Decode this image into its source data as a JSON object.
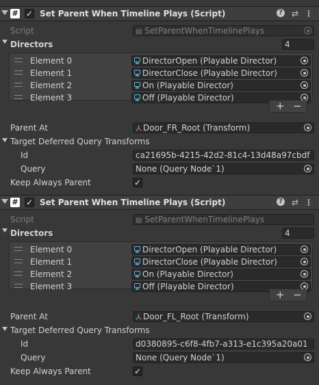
{
  "components": [
    {
      "header_title": "Set Parent When Timeline Plays (Script)",
      "script_label": "Script",
      "script_value": "SetParentWhenTimelinePlays",
      "directors_label": "Directors",
      "directors_count": "4",
      "elements": [
        {
          "label": "Element 0",
          "value": "DirectorOpen (Playable Director)"
        },
        {
          "label": "Element 1",
          "value": "DirectorClose (Playable Director)"
        },
        {
          "label": "Element 2",
          "value": "On (Playable Director)"
        },
        {
          "label": "Element 3",
          "value": "Off (Playable Director)"
        }
      ],
      "parent_at_label": "Parent At",
      "parent_at_value": "Door_FR_Root (Transform)",
      "target_label": "Target Deferred Query Transforms",
      "id_label": "Id",
      "id_value": "ca21695b-4215-42d2-81c4-13d48a97cbdf",
      "query_label": "Query",
      "query_value": "None (Query Node`1)",
      "keep_label": "Keep Always Parent",
      "keep_checked": true
    },
    {
      "header_title": "Set Parent When Timeline Plays (Script)",
      "script_label": "Script",
      "script_value": "SetParentWhenTimelinePlays",
      "directors_label": "Directors",
      "directors_count": "4",
      "elements": [
        {
          "label": "Element 0",
          "value": "DirectorOpen (Playable Director)"
        },
        {
          "label": "Element 1",
          "value": "DirectorClose (Playable Director)"
        },
        {
          "label": "Element 2",
          "value": "On (Playable Director)"
        },
        {
          "label": "Element 3",
          "value": "Off (Playable Director)"
        }
      ],
      "parent_at_label": "Parent At",
      "parent_at_value": "Door_FL_Root (Transform)",
      "target_label": "Target Deferred Query Transforms",
      "id_label": "Id",
      "id_value": "d0380895-c6f8-4fb7-a313-e1c395a20a01",
      "query_label": "Query",
      "query_value": "None (Query Node`1)",
      "keep_label": "Keep Always Parent",
      "keep_checked": true
    }
  ],
  "icons": {
    "fold": "fold-triangle-icon",
    "script": "script-hash-icon",
    "help": "help-icon",
    "presets": "presets-sliders-icon",
    "menu": "kebab-menu-icon",
    "picker": "object-picker-icon",
    "director": "playable-director-icon",
    "transform": "transform-icon",
    "add": "plus-icon",
    "remove": "minus-icon",
    "check": "checkmark-icon"
  },
  "colors": {
    "background": "#383838",
    "header": "#3e3e3e",
    "field": "#2a2a2a",
    "text": "#d2d2d2",
    "disabled_text": "#7f7f7f",
    "director_icon": "#5fb4d8"
  }
}
